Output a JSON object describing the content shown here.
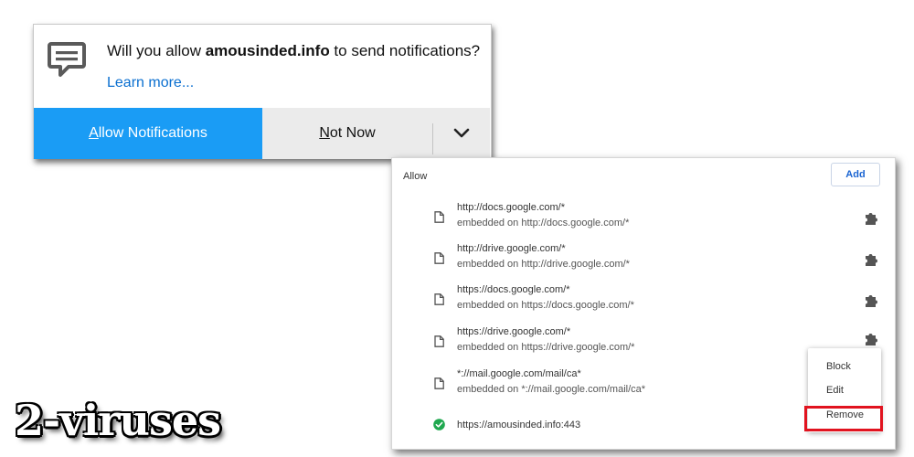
{
  "notification": {
    "icon": "chat-bubble-icon",
    "question_prefix": "Will you allow ",
    "site": "amousinded.info",
    "question_suffix": " to send notifications?",
    "learn_more": "Learn more...",
    "allow_button": {
      "first": "A",
      "rest": "llow Notifications"
    },
    "not_now_button": {
      "first": "N",
      "rest": "ot Now"
    },
    "dropdown_icon": "chevron-down-icon",
    "colors": {
      "allow_bg": "#1a9cf5",
      "link": "#0a6fd0",
      "secondary_bg": "#ebebeb"
    }
  },
  "panel": {
    "section_label": "Allow",
    "add_button": "Add",
    "sites": [
      {
        "url": "http://docs.google.com/*",
        "embedded": "embedded on http://docs.google.com/*",
        "icon": "file-icon",
        "extension_icon": "puzzle-icon"
      },
      {
        "url": "http://drive.google.com/*",
        "embedded": "embedded on http://drive.google.com/*",
        "icon": "file-icon",
        "extension_icon": "puzzle-icon"
      },
      {
        "url": "https://docs.google.com/*",
        "embedded": "embedded on https://docs.google.com/*",
        "icon": "file-icon",
        "extension_icon": "puzzle-icon"
      },
      {
        "url": "https://drive.google.com/*",
        "embedded": "embedded on https://drive.google.com/*",
        "icon": "file-icon",
        "extension_icon": "puzzle-icon"
      },
      {
        "url": "*://mail.google.com/mail/ca*",
        "embedded": "embedded on *://mail.google.com/mail/ca*",
        "icon": "file-icon"
      },
      {
        "url": "https://amousinded.info:443",
        "icon": "check-circle-icon"
      }
    ]
  },
  "context_menu": {
    "items": [
      "Block",
      "Edit",
      "Remove"
    ],
    "highlight_color": "#e1131f"
  },
  "watermark": "2-viruses"
}
